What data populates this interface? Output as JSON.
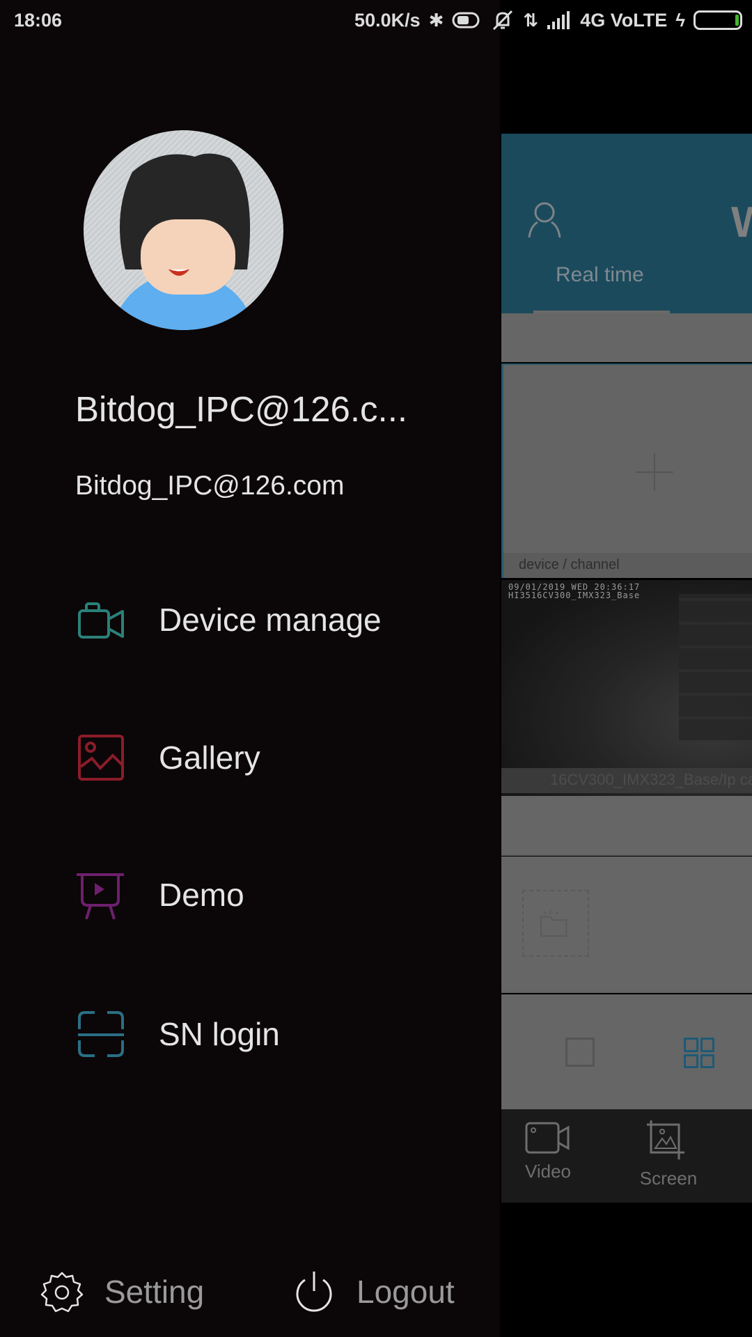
{
  "status_bar": {
    "time": "18:06",
    "net_speed": "50.0K/s",
    "network": "4G VoLTE",
    "icons": [
      "bluetooth-icon",
      "toggle-icon",
      "mute-icon",
      "data-arrows-icon",
      "signal-icon",
      "charging-icon",
      "battery-icon"
    ]
  },
  "drawer": {
    "user": {
      "display_name": "Bitdog_IPC@126.c...",
      "email": "Bitdog_IPC@126.com"
    },
    "menu": [
      {
        "label": "Device manage",
        "icon": "video-camera-icon",
        "color": "#2a8079"
      },
      {
        "label": "Gallery",
        "icon": "image-icon",
        "color": "#8b1c2a"
      },
      {
        "label": "Demo",
        "icon": "presentation-icon",
        "color": "#6e1f6e"
      },
      {
        "label": "SN login",
        "icon": "scan-icon",
        "color": "#2a6f85"
      }
    ],
    "footer": {
      "setting_label": "Setting",
      "logout_label": "Logout"
    }
  },
  "main_screen": {
    "header_title": "W",
    "tabs": [
      "Real time"
    ],
    "add_tile_label": "device / channel",
    "camera": {
      "osd_line1": "09/01/2019 WED 20:36:17",
      "osd_line2": "HI3516CV300_IMX323_Base",
      "caption": "16CV300_IMX323_Base/Ip ca"
    },
    "bottom_nav": [
      {
        "label": "Video",
        "icon": "video-icon"
      },
      {
        "label": "Screen",
        "icon": "screenshot-icon"
      }
    ],
    "accent_color": "#1d5a77"
  }
}
